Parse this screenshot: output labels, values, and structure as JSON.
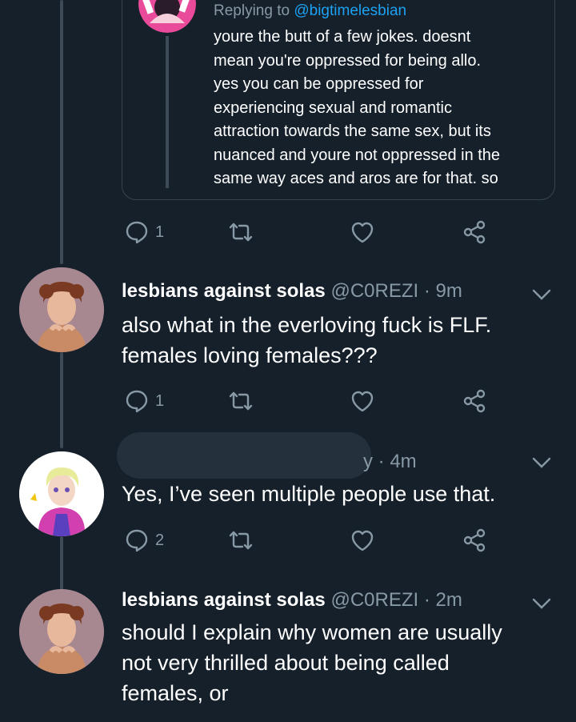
{
  "quoted": {
    "replying_prefix": "Replying to ",
    "replying_handle": "@bigtimelesbian",
    "lines": [
      "youre the butt of a few jokes. doesnt",
      "mean you're oppressed for being allo.",
      "yes you can be oppressed for",
      "experiencing sexual and romantic",
      "attraction towards the same sex, but its",
      "nuanced and youre not oppressed in the",
      "same way aces and aros are for that. so"
    ]
  },
  "quoted_actions": {
    "reply_count": "1"
  },
  "tweets": [
    {
      "name": "lesbians against solas",
      "meta": " @C0REZI · 9m",
      "lines": [
        "also what in the everloving fuck is FLF.",
        "females loving females???"
      ],
      "reply_count": "1"
    },
    {
      "meta_partial": "y · 4m",
      "lines": [
        "Yes, I’ve seen multiple people use that."
      ],
      "reply_count": "2"
    },
    {
      "name": "lesbians against solas",
      "meta": " @C0REZI · 2m",
      "lines": [
        "should I explain why women are usually",
        "not very thrilled about being called",
        "females, or"
      ]
    }
  ],
  "colors": {
    "background": "#15202b",
    "text": "#ffffff",
    "muted": "#8899a6",
    "link": "#1da1f2",
    "border": "#38444d"
  },
  "icons": [
    "reply-icon",
    "retweet-icon",
    "like-icon",
    "share-icon",
    "chevron-down-icon"
  ]
}
